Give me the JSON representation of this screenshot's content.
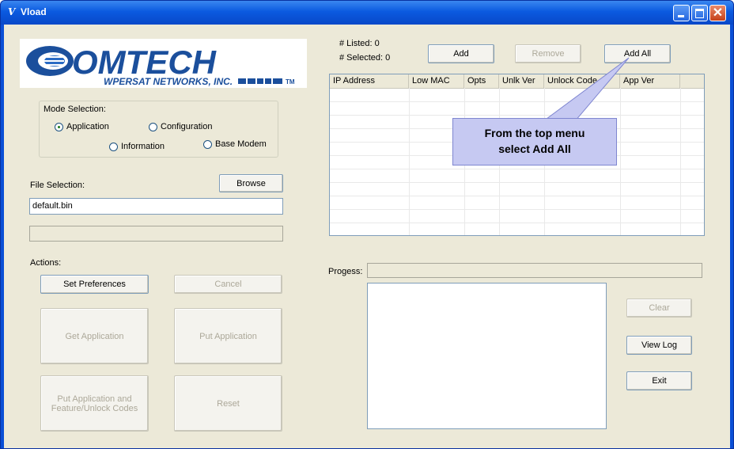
{
  "window": {
    "icon": "V",
    "title": "Vload"
  },
  "logo": {
    "company": "OMTECH",
    "subtitle": "WPERSAT NETWORKS, INC.",
    "tm": "TM"
  },
  "mode": {
    "label": "Mode Selection:",
    "options": {
      "application": "Application",
      "configuration": "Configuration",
      "information": "Information",
      "base_modem": "Base Modem"
    },
    "selected": "application"
  },
  "file": {
    "label": "File Selection:",
    "browse_label": "Browse",
    "value": "default.bin"
  },
  "actions": {
    "label": "Actions:",
    "set_preferences": "Set Preferences",
    "cancel": "Cancel",
    "get_application": "Get Application",
    "put_application": "Put Application",
    "put_app_codes_line1": "Put Application and",
    "put_app_codes_line2": "Feature/Unlock Codes",
    "reset": "Reset"
  },
  "status": {
    "listed": "# Listed: 0",
    "selected": "# Selected: 0"
  },
  "top_buttons": {
    "add": "Add",
    "remove": "Remove",
    "add_all": "Add All"
  },
  "table": {
    "columns": [
      "IP Address",
      "Low MAC",
      "Opts",
      "Unlk Ver",
      "Unlock Code",
      "App Ver"
    ],
    "rows": []
  },
  "callout": {
    "line1": "From the top menu",
    "line2": "select Add All"
  },
  "progress": {
    "label": "Progess:",
    "value": 0
  },
  "log_buttons": {
    "clear": "Clear",
    "view_log": "View Log",
    "exit": "Exit"
  },
  "colors": {
    "titlebar": "#0b5ae0",
    "window_bg": "#ece9d8",
    "callout_bg": "#c6c9f2",
    "logo_blue": "#1b4f9c"
  }
}
